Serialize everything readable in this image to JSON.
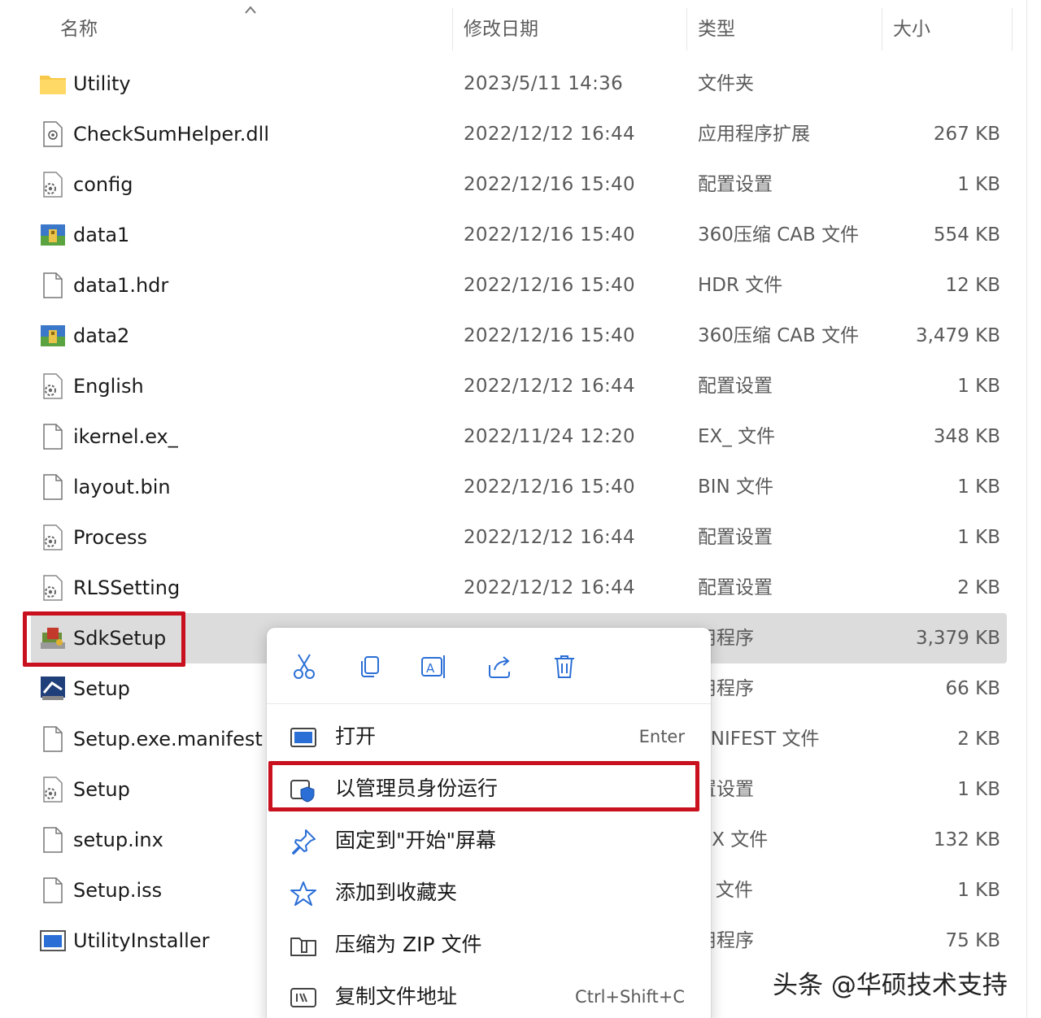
{
  "header": {
    "name": "名称",
    "modified": "修改日期",
    "type": "类型",
    "size": "大小"
  },
  "files": [
    {
      "name": "Utility",
      "date": "2023/5/11 14:36",
      "type": "文件夹",
      "size": "",
      "icon": "folder-icon"
    },
    {
      "name": "CheckSumHelper.dll",
      "date": "2022/12/12 16:44",
      "type": "应用程序扩展",
      "size": "267 KB",
      "icon": "dll-file-icon"
    },
    {
      "name": "config",
      "date": "2022/12/16 15:40",
      "type": "配置设置",
      "size": "1 KB",
      "icon": "settings-file-icon"
    },
    {
      "name": "data1",
      "date": "2022/12/16 15:40",
      "type": "360压缩 CAB 文件",
      "size": "554 KB",
      "icon": "cab-archive-icon"
    },
    {
      "name": "data1.hdr",
      "date": "2022/12/16 15:40",
      "type": "HDR 文件",
      "size": "12 KB",
      "icon": "blank-file-icon"
    },
    {
      "name": "data2",
      "date": "2022/12/16 15:40",
      "type": "360压缩 CAB 文件",
      "size": "3,479 KB",
      "icon": "cab-archive-icon"
    },
    {
      "name": "English",
      "date": "2022/12/12 16:44",
      "type": "配置设置",
      "size": "1 KB",
      "icon": "settings-file-icon"
    },
    {
      "name": "ikernel.ex_",
      "date": "2022/11/24 12:20",
      "type": "EX_ 文件",
      "size": "348 KB",
      "icon": "blank-file-icon"
    },
    {
      "name": "layout.bin",
      "date": "2022/12/16 15:40",
      "type": "BIN 文件",
      "size": "1 KB",
      "icon": "blank-file-icon"
    },
    {
      "name": "Process",
      "date": "2022/12/12 16:44",
      "type": "配置设置",
      "size": "1 KB",
      "icon": "settings-file-icon"
    },
    {
      "name": "RLSSetting",
      "date": "2022/12/12 16:44",
      "type": "配置设置",
      "size": "2 KB",
      "icon": "settings-file-icon"
    },
    {
      "name": "SdkSetup",
      "date": "",
      "type": "用程序",
      "size": "3,379 KB",
      "icon": "installer-icon"
    },
    {
      "name": "Setup",
      "date": "",
      "type": "用程序",
      "size": "66 KB",
      "icon": "setup-app-icon"
    },
    {
      "name": "Setup.exe.manifest",
      "date": "",
      "type": "ANIFEST 文件",
      "size": "2 KB",
      "icon": "blank-file-icon"
    },
    {
      "name": "Setup",
      "date": "",
      "type": "置设置",
      "size": "1 KB",
      "icon": "settings-file-icon"
    },
    {
      "name": "setup.inx",
      "date": "",
      "type": "NX 文件",
      "size": "132 KB",
      "icon": "blank-file-icon"
    },
    {
      "name": "Setup.iss",
      "date": "",
      "type": "S 文件",
      "size": "1 KB",
      "icon": "blank-file-icon"
    },
    {
      "name": "UtilityInstaller",
      "date": "",
      "type": "用程序",
      "size": "75 KB",
      "icon": "app-window-icon"
    }
  ],
  "context_menu": {
    "quick_actions": [
      "cut-icon",
      "copy-icon",
      "rename-icon",
      "share-icon",
      "delete-icon"
    ],
    "items": [
      {
        "label": "打开",
        "shortcut": "Enter",
        "icon": "open-window-icon"
      },
      {
        "label": "以管理员身份运行",
        "shortcut": "",
        "icon": "admin-shield-icon"
      },
      {
        "label": "固定到\"开始\"屏幕",
        "shortcut": "",
        "icon": "pin-icon"
      },
      {
        "label": "添加到收藏夹",
        "shortcut": "",
        "icon": "star-icon"
      },
      {
        "label": "压缩为 ZIP 文件",
        "shortcut": "",
        "icon": "zip-folder-icon"
      },
      {
        "label": "复制文件地址",
        "shortcut": "Ctrl+Shift+C",
        "icon": "copy-path-icon"
      }
    ]
  },
  "watermark": "头条 @华硕技术支持",
  "colors": {
    "highlight_border": "#c8101e",
    "selected_row": "#dcdcdc",
    "accent": "#2b6fd6"
  }
}
